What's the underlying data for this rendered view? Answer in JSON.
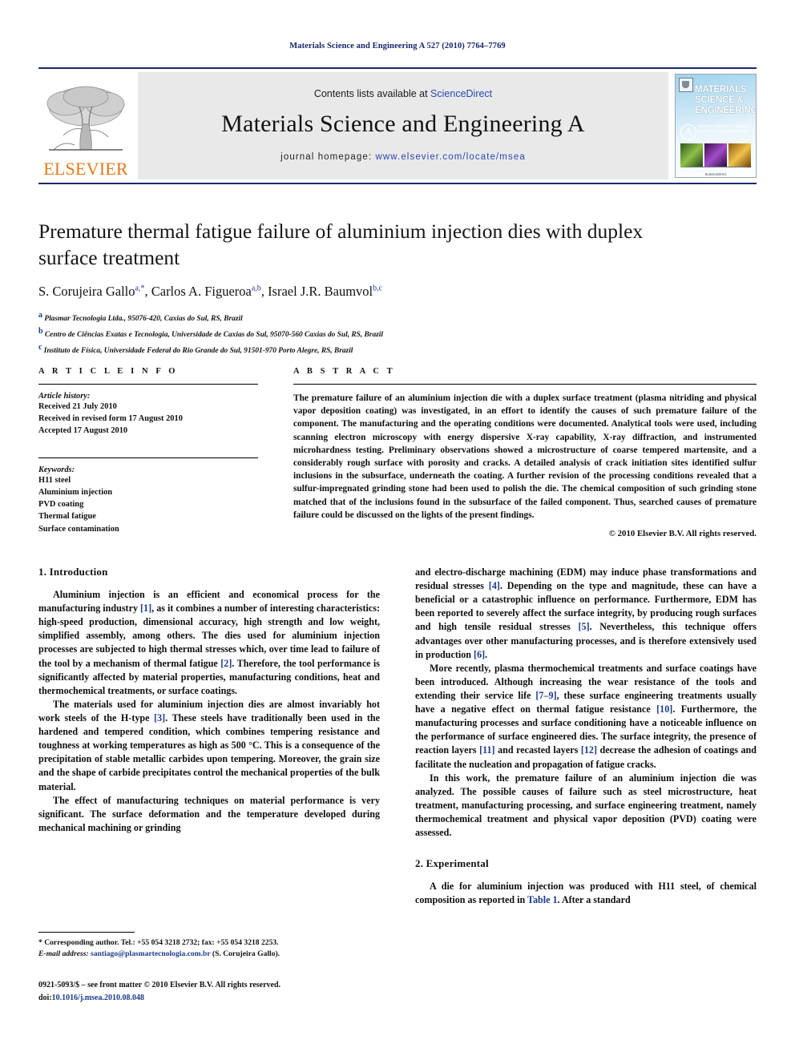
{
  "running_head": "Materials Science and Engineering A 527 (2010) 7764–7769",
  "masthead": {
    "publisher_name": "ELSEVIER",
    "contents_prefix": "Contents lists available at ",
    "contents_link": "ScienceDirect",
    "journal_title": "Materials Science and Engineering A",
    "homepage_prefix": "journal homepage: ",
    "homepage_url": "www.elsevier.com/locate/msea",
    "cover": {
      "title_line1": "MATERIALS",
      "title_line2": "SCIENCE &",
      "title_line3": "ENGINEERING",
      "series_letter": "A",
      "series_sub": "Structural Materials: Properties, Microstructure and Processing",
      "footer": "ScienceDirect"
    }
  },
  "article": {
    "title": "Premature thermal fatigue failure of aluminium injection dies with duplex surface treatment",
    "authors": "S. Corujeira Gallo, Carlos A. Figueroa, Israel J.R. Baumvol",
    "author_list": [
      {
        "name": "S. Corujeira Gallo",
        "marks": "a,*"
      },
      {
        "name": "Carlos A. Figueroa",
        "marks": "a,b"
      },
      {
        "name": "Israel J.R. Baumvol",
        "marks": "b,c"
      }
    ],
    "affiliations": [
      {
        "mark": "a",
        "text": "Plasmar Tecnologia Ltda., 95076-420, Caxias do Sul, RS, Brazil"
      },
      {
        "mark": "b",
        "text": "Centro de Ciências Exatas e Tecnologia, Universidade de Caxias do Sul, 95070-560 Caxias do Sul, RS, Brazil"
      },
      {
        "mark": "c",
        "text": "Instituto de Física, Universidade Federal do Rio Grande do Sul, 91501-970 Porto Alegre, RS, Brazil"
      }
    ]
  },
  "article_info": {
    "heading": "A R T I C L E    I N F O",
    "history_label": "Article history:",
    "history": [
      "Received 21 July 2010",
      "Received in revised form 17 August 2010",
      "Accepted 17 August 2010"
    ],
    "keywords_label": "Keywords:",
    "keywords": [
      "H11 steel",
      "Aluminium injection",
      "PVD coating",
      "Thermal fatigue",
      "Surface contamination"
    ]
  },
  "abstract": {
    "heading": "A B S T R A C T",
    "text": "The premature failure of an aluminium injection die with a duplex surface treatment (plasma nitriding and physical vapor deposition coating) was investigated, in an effort to identify the causes of such premature failure of the component. The manufacturing and the operating conditions were documented. Analytical tools were used, including scanning electron microscopy with energy dispersive X-ray capability, X-ray diffraction, and instrumented microhardness testing. Preliminary observations showed a microstructure of coarse tempered martensite, and a considerably rough surface with porosity and cracks. A detailed analysis of crack initiation sites identified sulfur inclusions in the subsurface, underneath the coating. A further revision of the processing conditions revealed that a sulfur-impregnated grinding stone had been used to polish the die. The chemical composition of such grinding stone matched that of the inclusions found in the subsurface of the failed component. Thus, searched causes of premature failure could be discussed on the lights of the present findings.",
    "copyright": "© 2010 Elsevier B.V. All rights reserved."
  },
  "sections": {
    "introduction_heading": "1.  Introduction",
    "experimental_heading": "2.  Experimental"
  },
  "paragraphs": {
    "left": [
      "Aluminium injection is an efficient and economical process for the manufacturing industry [1], as it combines a number of interesting characteristics: high-speed production, dimensional accuracy, high strength and low weight, simplified assembly, among others. The dies used for aluminium injection processes are subjected to high thermal stresses which, over time lead to failure of the tool by a mechanism of thermal fatigue [2]. Therefore, the tool performance is significantly affected by material properties, manufacturing conditions, heat and thermochemical treatments, or surface coatings.",
      "The materials used for aluminium injection dies are almost invariably hot work steels of the H-type [3]. These steels have traditionally been used in the hardened and tempered condition, which combines tempering resistance and toughness at working temperatures as high as 500 °C. This is a consequence of the precipitation of stable metallic carbides upon tempering. Moreover, the grain size and the shape of carbide precipitates control the mechanical properties of the bulk material.",
      "The effect of manufacturing techniques on material performance is very significant. The surface deformation and the temperature developed during mechanical machining or grinding"
    ],
    "right": [
      "and electro-discharge machining (EDM) may induce phase transformations and residual stresses [4]. Depending on the type and magnitude, these can have a beneficial or a catastrophic influence on performance. Furthermore, EDM has been reported to severely affect the surface integrity, by producing rough surfaces and high tensile residual stresses [5]. Nevertheless, this technique offers advantages over other manufacturing processes, and is therefore extensively used in production [6].",
      "More recently, plasma thermochemical treatments and surface coatings have been introduced. Although increasing the wear resistance of the tools and extending their service life [7–9], these surface engineering treatments usually have a negative effect on thermal fatigue resistance [10]. Furthermore, the manufacturing processes and surface conditioning have a noticeable influence on the performance of surface engineered dies. The surface integrity, the presence of reaction layers [11] and recasted layers [12] decrease the adhesion of coatings and facilitate the nucleation and propagation of fatigue cracks.",
      "In this work, the premature failure of an aluminium injection die was analyzed. The possible causes of failure such as steel microstructure, heat treatment, manufacturing processing, and surface engineering treatment, namely thermochemical treatment and physical vapor deposition (PVD) coating were assessed.",
      "A die for aluminium injection was produced with H11 steel, of chemical composition as reported in Table 1. After a standard"
    ]
  },
  "footnote": {
    "corresponding": "* Corresponding author. Tel.: +55 054 3218 2732; fax: +55 054 3218 2253.",
    "email_label": "E-mail address: ",
    "email": "santiago@plasmartecnologia.com.br",
    "email_suffix": " (S. Corujeira Gallo)."
  },
  "imprint": {
    "line1": "0921-5093/$ – see front matter © 2010 Elsevier B.V. All rights reserved.",
    "doi_label": "doi:",
    "doi": "10.1016/j.msea.2010.08.048"
  },
  "colors": {
    "accent_blue": "#1c3a8a",
    "link_blue": "#2b47b5",
    "elsevier_orange": "#e77817",
    "header_rule": "#1b2a6b",
    "banner_bg": "#e9e9e9"
  }
}
